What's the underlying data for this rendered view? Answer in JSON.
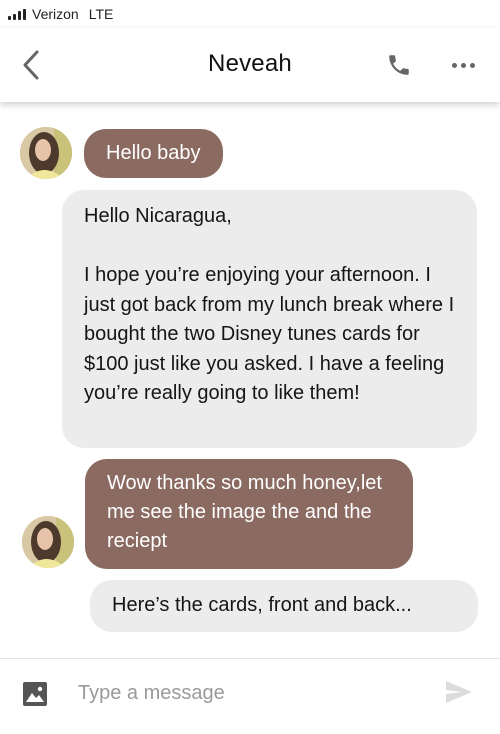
{
  "status_bar": {
    "carrier": "Verizon",
    "network": "LTE"
  },
  "header": {
    "title": "Neveah",
    "back_icon": "chevron-left-icon",
    "call_icon": "phone-icon",
    "more_icon": "more-icon"
  },
  "messages": [
    {
      "direction": "outgoing",
      "text": "Hello baby"
    },
    {
      "direction": "incoming",
      "text": "Hello Nicaragua,\n\nI hope you’re enjoying your afternoon. I just got back from my lunch break where I bought the two Disney tunes cards for $100 just like you asked. I have a feeling you’re really going to like them!"
    },
    {
      "direction": "outgoing",
      "text": "Wow thanks so much honey,let me see the image the and the reciept"
    },
    {
      "direction": "incoming",
      "text": "Here’s the cards, front and back..."
    }
  ],
  "composer": {
    "placeholder": "Type a message",
    "image_icon": "image-icon",
    "send_icon": "send-icon"
  },
  "colors": {
    "outgoing_bubble": "#8a6a61",
    "incoming_bubble": "#ececec"
  }
}
